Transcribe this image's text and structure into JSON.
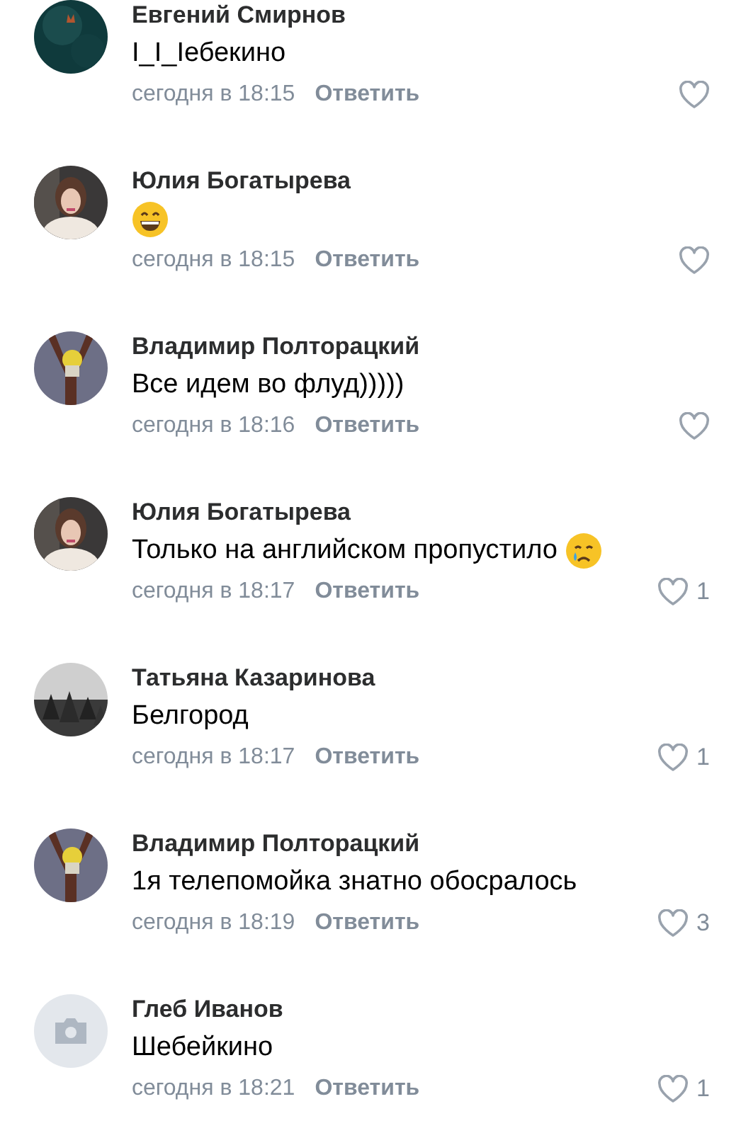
{
  "comments": [
    {
      "author": "Евгений Смирнов",
      "text": "I_I_Iебекино",
      "time": "сегодня в 18:15",
      "reply": "Ответить"
    },
    {
      "author": "Юлия Богатырева",
      "emoji": {
        "kind": "grin"
      },
      "time": "сегодня в 18:15",
      "reply": "Ответить"
    },
    {
      "author": "Владимир Полторацкий",
      "text": "Все идем во флуд)))))",
      "time": "сегодня в 18:16",
      "reply": "Ответить"
    },
    {
      "author": "Юлия Богатырева",
      "text": "Только на английском пропустило",
      "emoji": {
        "kind": "cry"
      },
      "time": "сегодня в 18:17",
      "reply": "Ответить",
      "likes": "1"
    },
    {
      "author": "Татьяна Казаринова",
      "text": "Белгород",
      "time": "сегодня в 18:17",
      "reply": "Ответить",
      "likes": "1"
    },
    {
      "author": "Владимир Полторацкий",
      "text": "1я телепомойка знатно обосралось",
      "time": "сегодня в 18:19",
      "reply": "Ответить",
      "likes": "3"
    },
    {
      "author": "Глеб Иванов",
      "avatar": {
        "kind": "placeholder"
      },
      "text": "Шебейкино",
      "time": "сегодня в 18:21",
      "reply": "Ответить",
      "likes": "1"
    }
  ]
}
